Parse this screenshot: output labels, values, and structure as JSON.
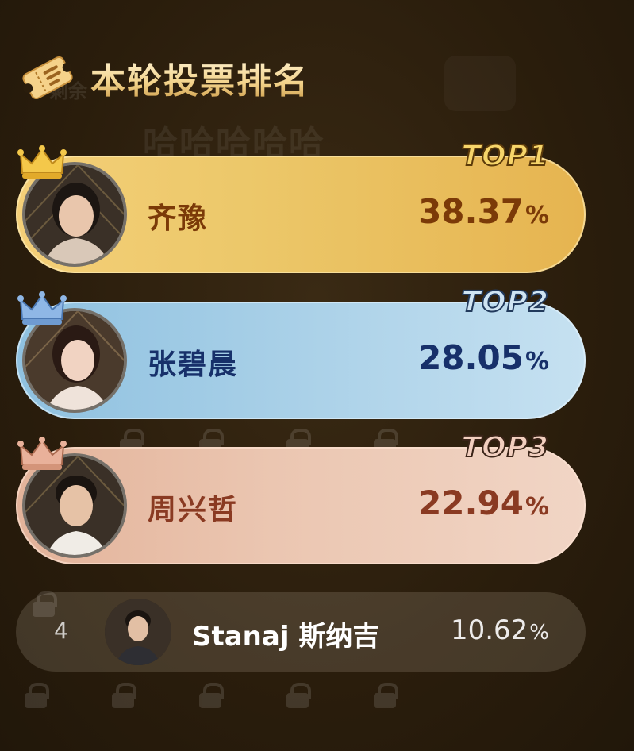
{
  "header": {
    "title": "本轮投票排名",
    "icon": "ticket-icon"
  },
  "background": {
    "ghost_text": "哈哈哈哈哈",
    "remaining_label": "剩余"
  },
  "rankings": [
    {
      "rank": 1,
      "badge": "TOP1",
      "name": "齐豫",
      "percent": "38.37",
      "unit": "%",
      "theme": "gold",
      "crown_color": "#f4c84a"
    },
    {
      "rank": 2,
      "badge": "TOP2",
      "name": "张碧晨",
      "percent": "28.05",
      "unit": "%",
      "theme": "blue",
      "crown_color": "#8fb7e6"
    },
    {
      "rank": 3,
      "badge": "TOP3",
      "name": "周兴哲",
      "percent": "22.94",
      "unit": "%",
      "theme": "peach",
      "crown_color": "#e9b19a"
    },
    {
      "rank": "4",
      "name": "Stanaj 斯纳吉",
      "percent": "10.62",
      "unit": "%"
    }
  ],
  "colors": {
    "background": "#2a1d0c",
    "gold": "#ecc86a",
    "blue": "#a7cfe7",
    "peach": "#ebc6b1"
  }
}
